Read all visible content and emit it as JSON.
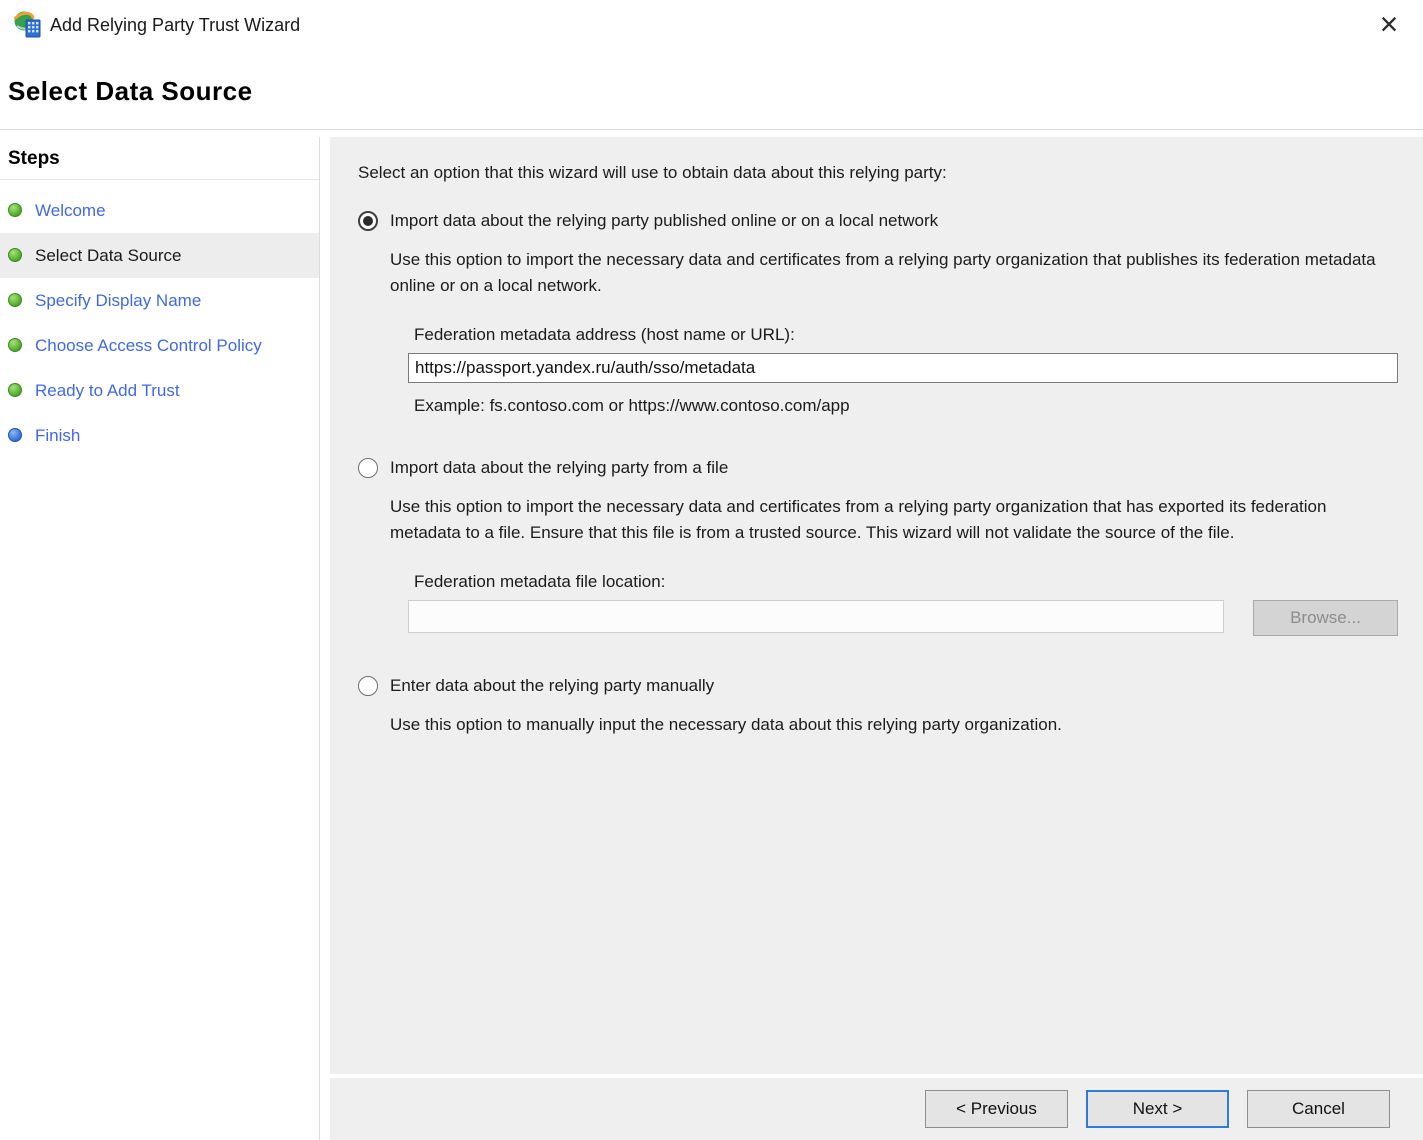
{
  "window": {
    "title": "Add Relying Party Trust Wizard",
    "close_glyph": "×"
  },
  "page": {
    "title": "Select Data Source"
  },
  "sidebar": {
    "heading": "Steps",
    "items": [
      {
        "label": "Welcome",
        "state": "done"
      },
      {
        "label": "Select Data Source",
        "state": "current"
      },
      {
        "label": "Specify Display Name",
        "state": "done"
      },
      {
        "label": "Choose Access Control Policy",
        "state": "done"
      },
      {
        "label": "Ready to Add Trust",
        "state": "done"
      },
      {
        "label": "Finish",
        "state": "upcoming"
      }
    ]
  },
  "content": {
    "intro": "Select an option that this wizard will use to obtain data about this relying party:",
    "option_online": {
      "label": "Import data about the relying party published online or on a local network",
      "selected": true,
      "description": "Use this option to import the necessary data and certificates from a relying party organization that publishes its federation metadata online or on a local network.",
      "address_label": "Federation metadata address (host name or URL):",
      "address_value": "https://passport.yandex.ru/auth/sso/metadata",
      "example": "Example: fs.contoso.com or https://www.contoso.com/app"
    },
    "option_file": {
      "label": "Import data about the relying party from a file",
      "selected": false,
      "description": "Use this option to import the necessary data and certificates from a relying party organization that has exported its federation metadata to a file. Ensure that this file is from a trusted source.  This wizard will not validate the source of the file.",
      "file_label": "Federation metadata file location:",
      "file_value": "",
      "browse_label": "Browse..."
    },
    "option_manual": {
      "label": "Enter data about the relying party manually",
      "selected": false,
      "description": "Use this option to manually input the necessary data about this relying party organization."
    }
  },
  "footer": {
    "previous_label": "< Previous",
    "next_label": "Next >",
    "cancel_label": "Cancel"
  },
  "colors": {
    "accent_link_blue": "#4169E1",
    "step_done_green": "#479d22",
    "step_upcoming_blue": "#2b66cf",
    "panel_gray": "#efefef",
    "default_button_border": "#2f7cd6"
  }
}
